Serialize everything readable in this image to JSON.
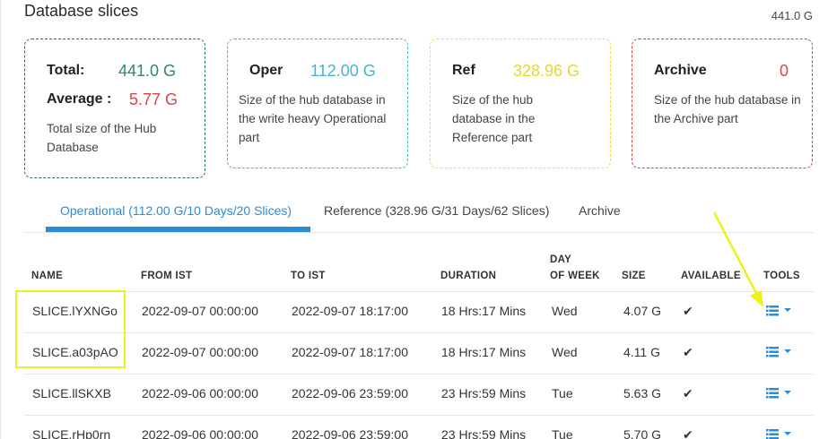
{
  "header": {
    "title": "Database slices",
    "total_size": "441.0 G"
  },
  "cards": {
    "total": {
      "total_label": "Total:",
      "total_value": "441.0 G",
      "average_label": "Average :",
      "average_value": "5.77 G",
      "description": "Total size of the Hub Database",
      "accent": "#2e8a5f",
      "average_color": "#d9454a"
    },
    "oper": {
      "label": "Oper",
      "value": "112.00 G",
      "description": "Size of the hub database in the write heavy Operational part",
      "accent": "#48b4d0"
    },
    "ref": {
      "label": "Ref",
      "value": "328.96 G",
      "description": "Size of the hub database in the Reference part",
      "accent": "#ecdf3e"
    },
    "archive": {
      "label": "Archive",
      "value": "0",
      "description": "Size of the hub database in the Archive part",
      "accent": "#d9454a"
    }
  },
  "tabs": [
    {
      "label": "Operational (112.00 G/10 Days/20 Slices)",
      "active": true
    },
    {
      "label": "Reference (328.96 G/31 Days/62 Slices)",
      "active": false
    },
    {
      "label": "Archive",
      "active": false
    }
  ],
  "table": {
    "columns": {
      "name": "NAME",
      "from": "FROM IST",
      "to": "TO IST",
      "duration": "DURATION",
      "day_line1": "DAY",
      "day_line2": "OF WEEK",
      "size": "SIZE",
      "available": "AVAILABLE",
      "tools": "TOOLS"
    },
    "rows": [
      {
        "name": "SLICE.lYXNGo",
        "from": "2022-09-07 00:00:00",
        "to": "2022-09-07 18:17:00",
        "duration": "18 Hrs:17 Mins",
        "day": "Wed",
        "size": "4.07 G",
        "available": "✔"
      },
      {
        "name": "SLICE.a03pAO",
        "from": "2022-09-07 00:00:00",
        "to": "2022-09-07 18:17:00",
        "duration": "18 Hrs:17 Mins",
        "day": "Wed",
        "size": "4.11 G",
        "available": "✔"
      },
      {
        "name": "SLICE.llSKXB",
        "from": "2022-09-06 00:00:00",
        "to": "2022-09-06 23:59:00",
        "duration": "23 Hrs:59 Mins",
        "day": "Tue",
        "size": "5.63 G",
        "available": "✔"
      },
      {
        "name": "SLICE.rHp0rn",
        "from": "2022-09-06 00:00:00",
        "to": "2022-09-06 23:59:00",
        "duration": "23 Hrs:59 Mins",
        "day": "Tue",
        "size": "5.70 G",
        "available": "✔"
      }
    ]
  },
  "icons": {
    "tool_list": "list-icon",
    "tool_menu": "chevron-down-icon",
    "available": "check-icon"
  },
  "colors": {
    "accent_blue": "#2a8dd4",
    "highlight_yellow": "#f0f01e"
  }
}
